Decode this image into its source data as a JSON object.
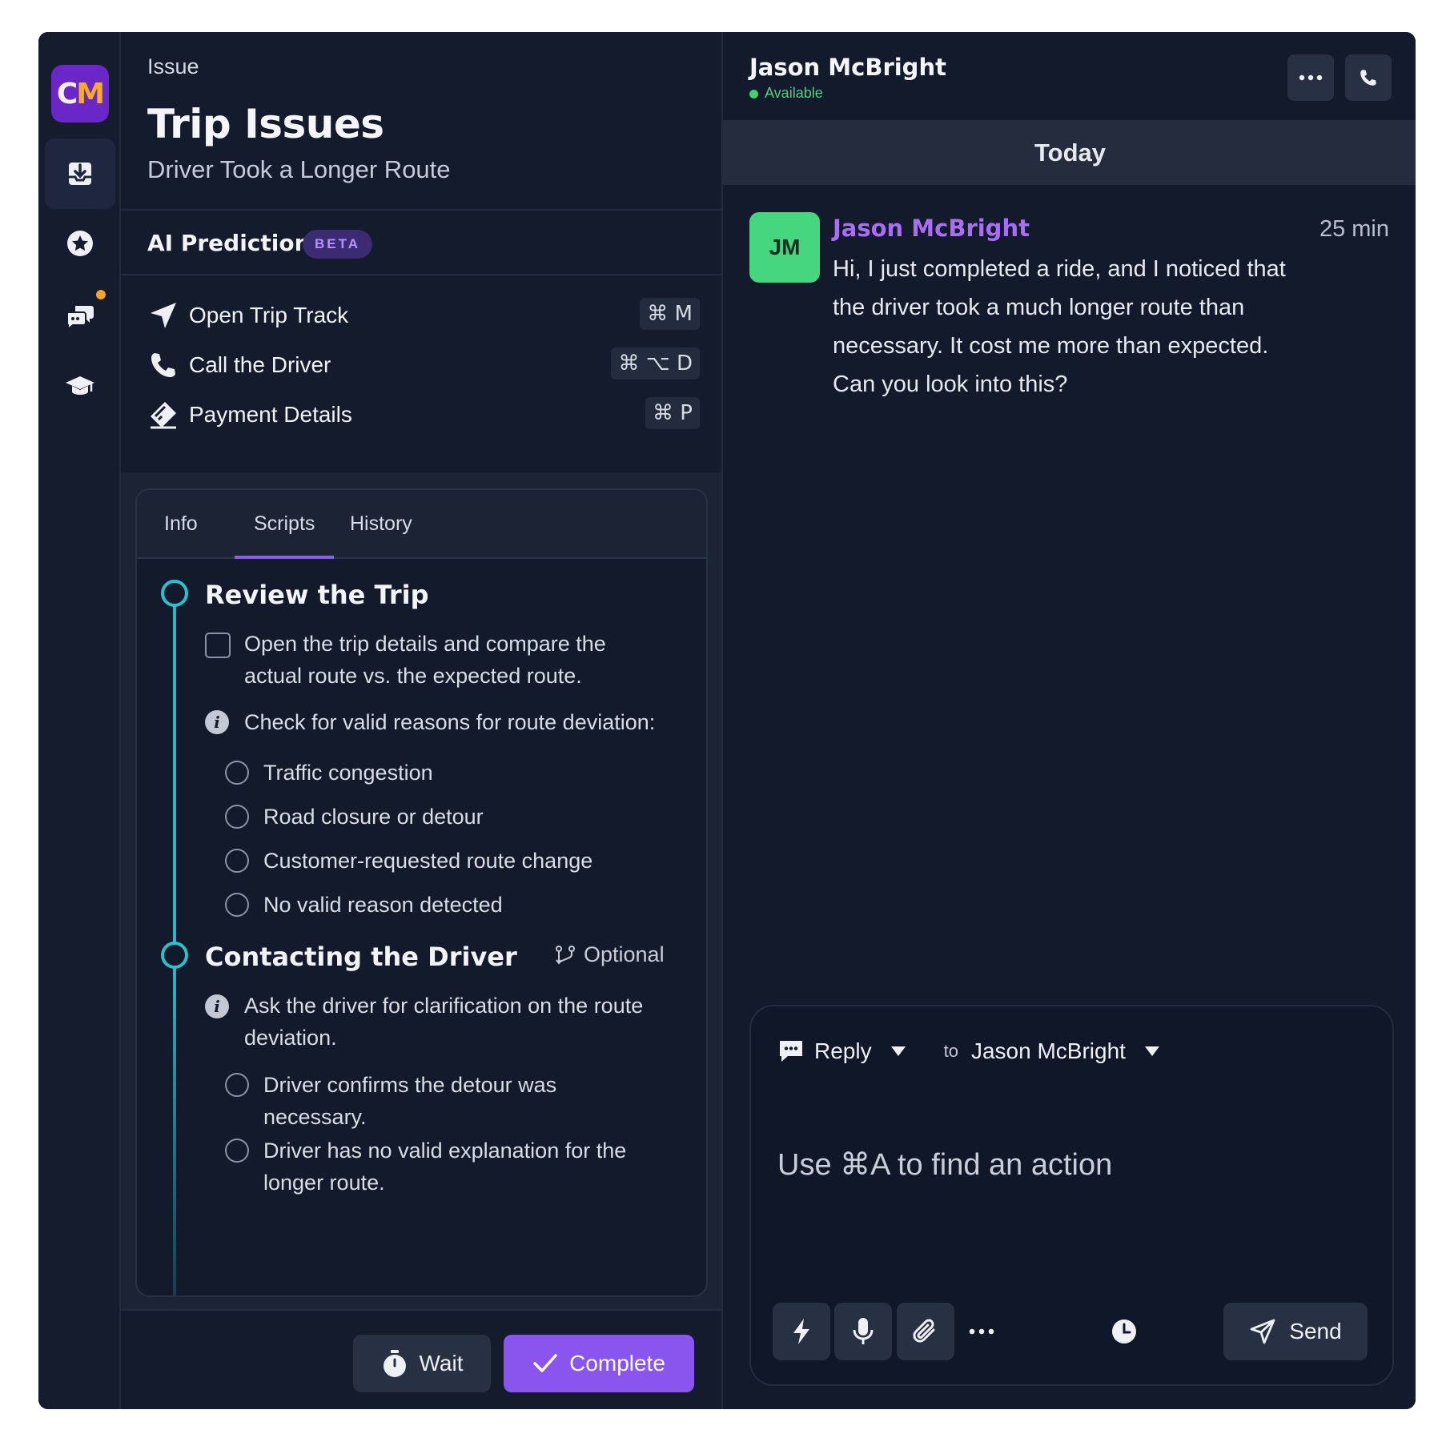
{
  "nav": {
    "logo_c": "C",
    "logo_m": "M",
    "items": [
      {
        "icon": "inbox-download-icon",
        "active": true
      },
      {
        "icon": "star-badge-icon",
        "active": false
      },
      {
        "icon": "chat-bubbles-icon",
        "active": false,
        "badge": true
      },
      {
        "icon": "graduation-cap-icon",
        "active": false
      }
    ]
  },
  "issue": {
    "eyebrow": "Issue",
    "title": "Trip Issues",
    "subtitle": "Driver Took a Longer Route"
  },
  "ai": {
    "title": "AI Prediction",
    "badge": "BETA",
    "actions": [
      {
        "label": "Open Trip Track",
        "shortcut": "⌘ M",
        "icon": "navigation-arrow-icon"
      },
      {
        "label": "Call the Driver",
        "shortcut": "⌘ ⌥ D",
        "icon": "phone-icon"
      },
      {
        "label": "Payment Details",
        "shortcut": "⌘ P",
        "icon": "card-tag-icon"
      }
    ]
  },
  "tabs": {
    "items": [
      "Info",
      "Scripts",
      "History"
    ],
    "active": "Scripts"
  },
  "scripts": {
    "section1": {
      "title": "Review the Trip",
      "task_line1": "Open the trip details and compare the",
      "task_line2": "actual route vs. the expected route.",
      "info": "Check for valid reasons for route deviation:",
      "options": [
        "Traffic congestion",
        "Road closure or detour",
        "Customer-requested route change",
        "No valid reason detected"
      ]
    },
    "section2": {
      "title": "Contacting the Driver",
      "optional": "Optional",
      "info_line1": "Ask the driver for clarification on the route",
      "info_line2": "deviation.",
      "opt1_line1": "Driver confirms the detour was",
      "opt1_line2": "necessary.",
      "opt2_line1": "Driver has no valid explanation for the",
      "opt2_line2": "longer route."
    }
  },
  "footer": {
    "wait": "Wait",
    "complete": "Complete"
  },
  "chat": {
    "name": "Jason McBright",
    "status": "Available",
    "day": "Today",
    "message": {
      "initials": "JM",
      "author": "Jason McBright",
      "time": "25 min",
      "text": "Hi, I just completed a ride, and I noticed that the driver took a much longer route than necessary. It cost me more than expected. Can you look into this?"
    }
  },
  "composer": {
    "mode": "Reply",
    "to_label": "to",
    "recipient": "Jason McBright",
    "placeholder": "Use ⌘A to find an action",
    "send": "Send"
  },
  "colors": {
    "accent": "#8a55ee",
    "timeline": "#2bc0cc",
    "available": "#3fd072",
    "avatar": "#45d67f",
    "badge_dot": "#f4a52a"
  }
}
